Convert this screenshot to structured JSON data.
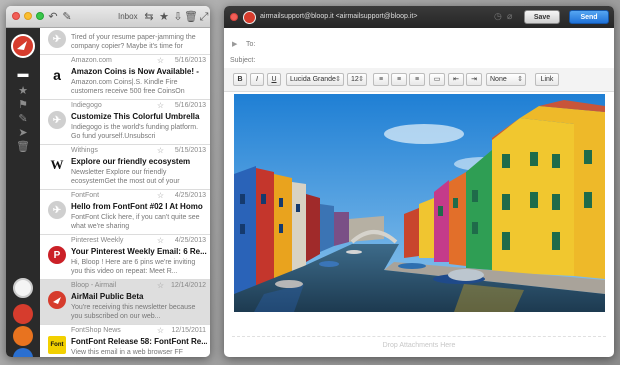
{
  "inbox_window": {
    "title": "Inbox",
    "toolbar_icons": [
      "undo-icon",
      "compose-icon",
      "reply-icon",
      "star-icon",
      "archive-icon",
      "trash-icon",
      "expand-icon"
    ]
  },
  "sidebar": {
    "items": [
      "airmail-account-icon",
      "inbox-tray-icon",
      "starred-icon",
      "flag-icon",
      "drafts-pencil-icon",
      "sent-icon",
      "trash-icon",
      "account-avatar-1",
      "account-avatar-2",
      "account-avatar-3",
      "account-avatar-4"
    ]
  },
  "messages": [
    {
      "sender": "",
      "date": "",
      "subject": "",
      "preview": "Tired of your resume paper-jamming the company copier? Maybe it's time for"
    },
    {
      "sender": "Amazon.com",
      "date": "5/16/2013",
      "subject": "Amazon Coins is Now Available! -",
      "preview": "Amazon.com Coins|.S. Kindle Fire customers receive 500 free CoinsOn"
    },
    {
      "sender": "Indiegogo",
      "date": "5/16/2013",
      "subject": "Customize This Colorful Umbrella",
      "preview": "Indiegogo is the world's funding platform. Go fund yourself.Unsubscri"
    },
    {
      "sender": "Withings",
      "date": "5/15/2013",
      "subject": "Explore our friendly ecosystem",
      "preview": "Newsletter Explore our friendly ecosystemGet the most out of your"
    },
    {
      "sender": "FontFont",
      "date": "4/25/2013",
      "subject": "Hello from FontFont #02 I At Homo",
      "preview": "FontFont Click here, if you can't quite see what we're sharing"
    },
    {
      "sender": "Pinterest Weekly",
      "date": "4/25/2013",
      "subject": "Your Pinterest Weekly Email: 6 Re...",
      "preview": "Hi, Bloop ! Here are 6 pins we're inviting you this video on repeat: Meet R..."
    },
    {
      "sender": "Bloop - Airmail",
      "date": "12/14/2012",
      "subject": "AirMail Public Beta",
      "preview": "You're receiving this newsletter because you subscribed on our web..."
    },
    {
      "sender": "FontShop News",
      "date": "12/15/2011",
      "subject": "FontFont Release 58: FontFont Re...",
      "preview": "View this email in a web browser  FF"
    }
  ],
  "compose": {
    "from": "airmailsupport@bloop.it <airmailsupport@bloop.it>",
    "save_label": "Save",
    "send_label": "Send",
    "to_label": "To:",
    "subject_label": "Subject:",
    "format": {
      "bold": "B",
      "italic": "I",
      "underline": "U",
      "font": "Lucida Grande",
      "size": "12",
      "list_style": "None",
      "link": "Link"
    },
    "drop_hint": "Drop Attachments Here"
  },
  "colors": {
    "accent_red": "#d63c2d",
    "send_blue": "#2a7fe0"
  }
}
